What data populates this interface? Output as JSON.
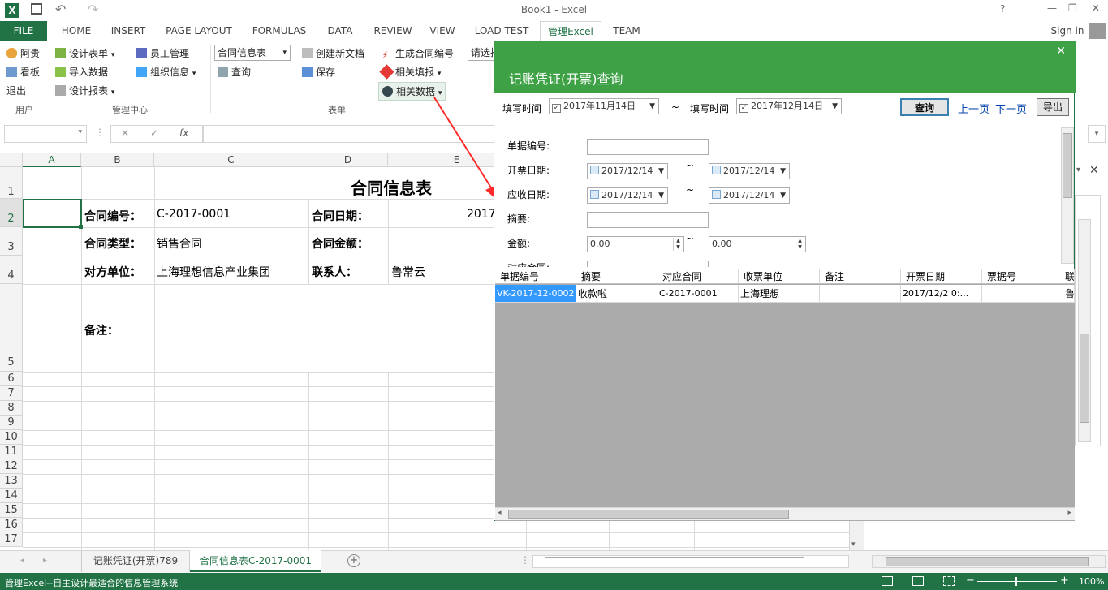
{
  "window": {
    "title": "Book1 - Excel",
    "help": "?",
    "minimize": "—",
    "restore": "❐",
    "close": "✕",
    "app_logo": "X"
  },
  "tabs": {
    "file": "FILE",
    "items": [
      "HOME",
      "INSERT",
      "PAGE LAYOUT",
      "FORMULAS",
      "DATA",
      "REVIEW",
      "VIEW",
      "LOAD TEST",
      "管理Excel",
      "TEAM"
    ],
    "sign_in": "Sign in"
  },
  "ribbon": {
    "user": {
      "a": "阿贵",
      "b": "看板",
      "c": "退出",
      "group": "用户"
    },
    "mgmt": {
      "a": "设计表单",
      "b": "导入数据",
      "c": "设计报表",
      "d": "员工管理",
      "e": "组织信息",
      "group": "管理中心"
    },
    "form": {
      "select": "合同信息表",
      "query": "查询",
      "new_doc": "创建新文档",
      "save": "保存",
      "gen": "生成合同编号",
      "fill": "相关填报",
      "data": "相关数据",
      "group": "表单"
    },
    "cut": "请选择"
  },
  "formula_bar": {
    "cancel": "✕",
    "confirm": "✓",
    "fx": "fx"
  },
  "sheet": {
    "columns": [
      "A",
      "B",
      "C",
      "D",
      "E"
    ],
    "rows": [
      "1",
      "2",
      "3",
      "4",
      "5",
      "6",
      "7",
      "8",
      "9",
      "10",
      "11",
      "12",
      "13",
      "14",
      "15",
      "16",
      "17"
    ],
    "title": "合同信息表",
    "contract_no_label": "合同编号：",
    "contract_no": "C-2017-0001",
    "contract_date_label": "合同日期：",
    "contract_date": "2017",
    "contract_type_label": "合同类型：",
    "contract_type": "销售合同",
    "amount_label": "合同金额：",
    "party_label": "对方单位：",
    "party": "上海理想信息产业集团",
    "contact_label": "联系人：",
    "contact": "鲁常云",
    "remark_label": "备注："
  },
  "sheet_tabs": [
    "记账凭证(开票)789",
    "合同信息表C-2017-0001"
  ],
  "status": {
    "text": "管理Excel--自主设计最适合的信息管理系统",
    "zoom": "100%"
  },
  "dialog": {
    "title": "记账凭证(开票)查询",
    "close": "✕",
    "fill_time_label": "填写时间",
    "date_from": "2017年11月14日",
    "tilde": "~",
    "date_to": "2017年12月14日",
    "query_btn": "查询",
    "prev": "上一页",
    "next": "下一页",
    "export": "导出",
    "fields": {
      "doc_no": "单据编号:",
      "invoice_date": "开票日期:",
      "receivable_date": "应收日期:",
      "summary": "摘要:",
      "amount": "金额:",
      "contract_cut": "对应合同:"
    },
    "date_value": "2017/12/14",
    "amount_from": "0.00",
    "amount_to": "0.00",
    "grid": {
      "headers": [
        "单据编号",
        "摘要",
        "对应合同",
        "收票单位",
        "备注",
        "开票日期",
        "票据号",
        "联"
      ],
      "row": [
        "VK-2017-12-0002",
        "收款啦",
        "C-2017-0001",
        "上海理想",
        "",
        "2017/12/2 0:...",
        "",
        "鲁"
      ]
    }
  }
}
